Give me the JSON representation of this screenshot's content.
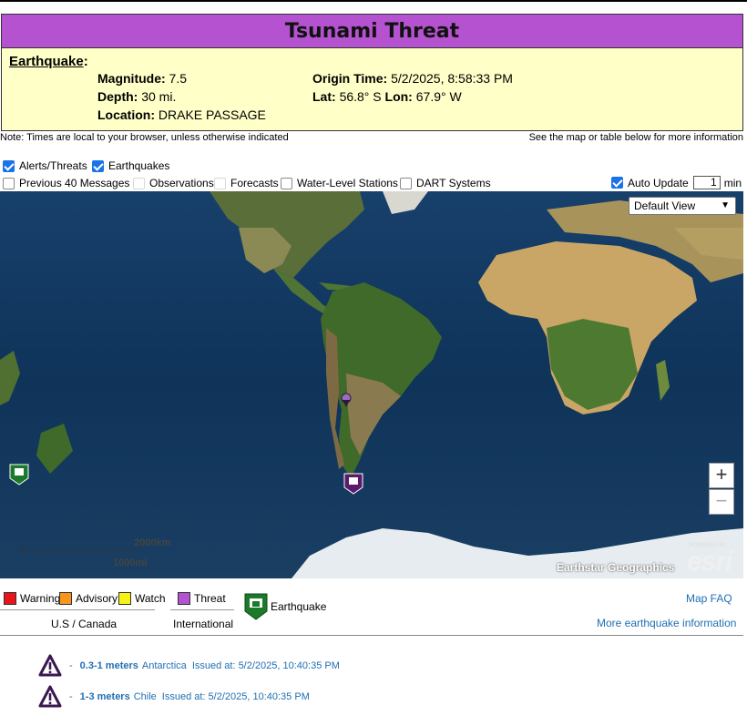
{
  "header": {
    "title": "Tsunami Threat"
  },
  "earthquake": {
    "heading": "Earthquake",
    "magnitude_label": "Magnitude:",
    "magnitude": "7.5",
    "depth_label": "Depth:",
    "depth": "30 mi.",
    "location_label": "Location:",
    "location": "DRAKE PASSAGE",
    "origin_label": "Origin Time:",
    "origin": "5/2/2025, 8:58:33 PM",
    "lat_label": "Lat:",
    "lat": "56.8° S",
    "lon_label": "Lon:",
    "lon": "67.9° W"
  },
  "notes": {
    "left": "Note: Times are local to your browser, unless otherwise indicated",
    "right": "See the map or table below for more information"
  },
  "layers": {
    "alerts": {
      "label": "Alerts/Threats",
      "checked": true
    },
    "earthquakes": {
      "label": "Earthquakes",
      "checked": true
    },
    "previous": {
      "label": "Previous 40 Messages",
      "checked": false
    },
    "observations": {
      "label": "Observations",
      "checked": false
    },
    "forecasts": {
      "label": "Forecasts",
      "checked": false
    },
    "water_level": {
      "label": "Water-Level Stations",
      "checked": false
    },
    "dart": {
      "label": "DART Systems",
      "checked": false
    }
  },
  "auto_update": {
    "label": "Auto Update",
    "value": "1",
    "unit": "min",
    "checked": true
  },
  "map": {
    "view_select": "Default View",
    "zoom_in": "+",
    "zoom_out": "−",
    "scale_km": "2000km",
    "scale_mi": "1000mi",
    "attribution": "Earthstar Geographics",
    "esri_label": "esri",
    "esri_powered": "POWERED BY"
  },
  "legend": {
    "warning": {
      "label": "Warning",
      "color": "#e8161c"
    },
    "advisory": {
      "label": "Advisory",
      "color": "#f7951d"
    },
    "watch": {
      "label": "Watch",
      "color": "#f7f215"
    },
    "threat": {
      "label": "Threat",
      "color": "#b452cf"
    },
    "earthquake": "Earthquake",
    "us_canada": "U.S / Canada",
    "international": "International"
  },
  "links": {
    "map_faq": "Map FAQ",
    "more_eq": "More earthquake information"
  },
  "threats": [
    {
      "dash": "-",
      "range": "0.3-1 meters",
      "location": "Antarctica",
      "issued": "Issued at: 5/2/2025, 10:40:35 PM"
    },
    {
      "dash": "-",
      "range": "1-3 meters",
      "location": "Chile",
      "issued": "Issued at: 5/2/2025, 10:40:35 PM"
    }
  ],
  "colors": {
    "threat": "#b452cf",
    "eq_panel": "#ffffc8",
    "link": "#1f6fb2",
    "earthquake_icon": "#1a7a2a"
  }
}
